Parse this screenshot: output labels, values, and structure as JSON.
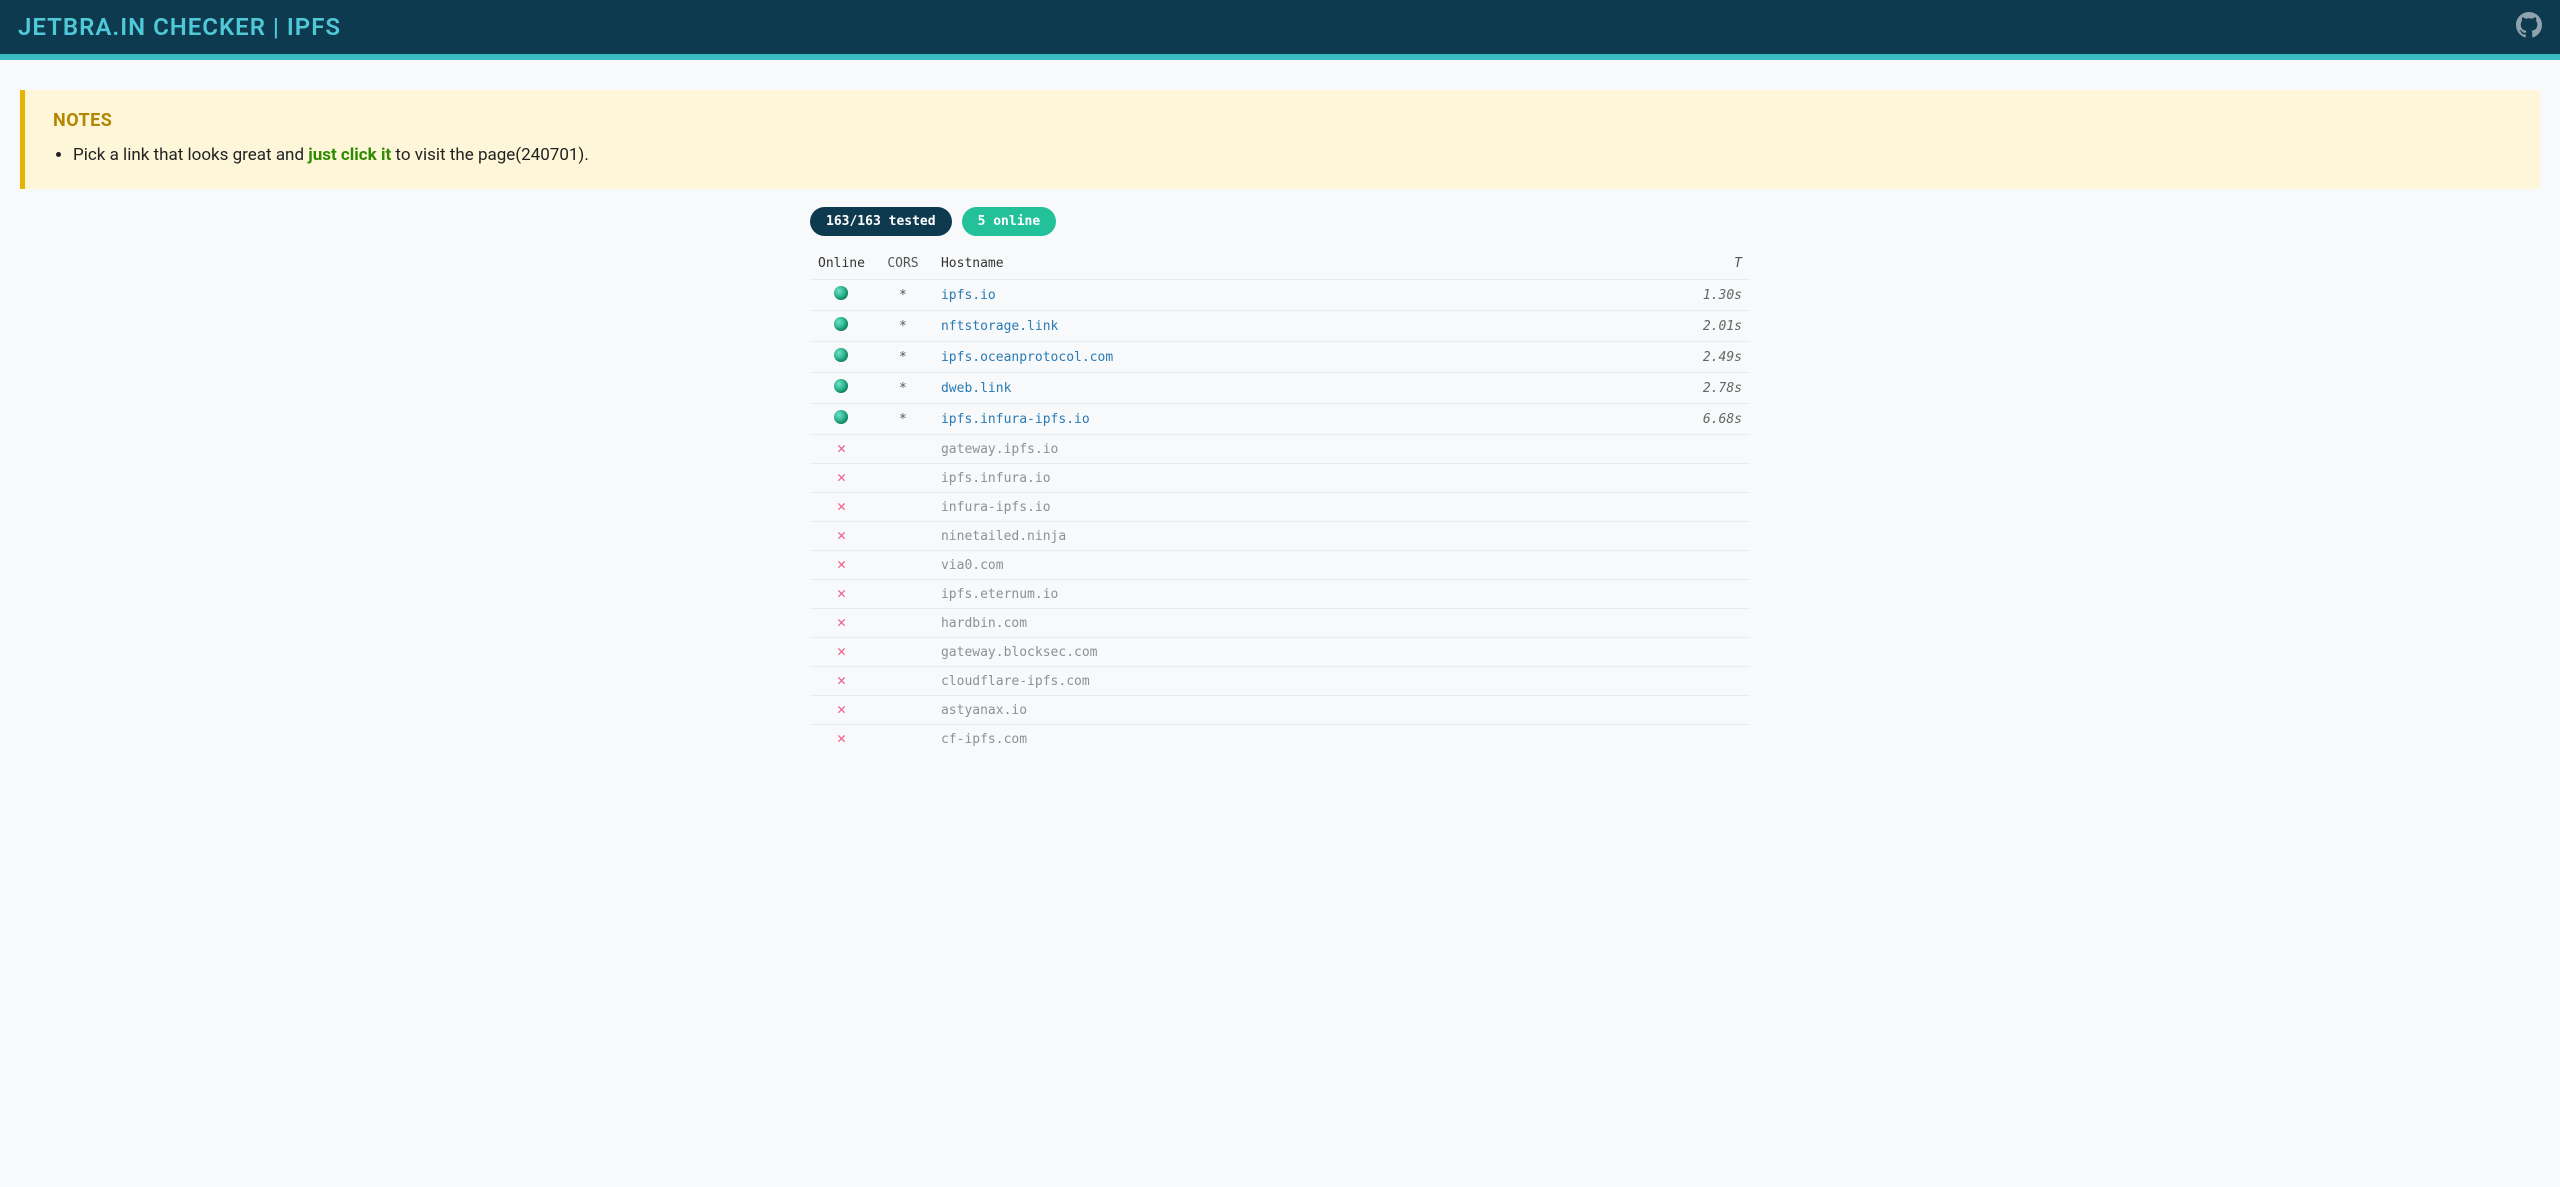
{
  "header": {
    "title": "JETBRA.IN CHECKER | IPFS"
  },
  "notes": {
    "heading": "NOTES",
    "line_pre": "Pick a link that looks great and ",
    "line_emph": "just click it",
    "line_post": " to visit the page(240701)."
  },
  "badges": {
    "tested": "163/163 tested",
    "online": "5 online"
  },
  "table": {
    "headers": {
      "online": "Online",
      "cors": "CORS",
      "hostname": "Hostname",
      "t": "T"
    },
    "rows": [
      {
        "online": true,
        "cors": "*",
        "host": "ipfs.io",
        "t": "1.30s"
      },
      {
        "online": true,
        "cors": "*",
        "host": "nftstorage.link",
        "t": "2.01s"
      },
      {
        "online": true,
        "cors": "*",
        "host": "ipfs.oceanprotocol.com",
        "t": "2.49s"
      },
      {
        "online": true,
        "cors": "*",
        "host": "dweb.link",
        "t": "2.78s"
      },
      {
        "online": true,
        "cors": "*",
        "host": "ipfs.infura-ipfs.io",
        "t": "6.68s"
      },
      {
        "online": false,
        "cors": "",
        "host": "gateway.ipfs.io",
        "t": ""
      },
      {
        "online": false,
        "cors": "",
        "host": "ipfs.infura.io",
        "t": ""
      },
      {
        "online": false,
        "cors": "",
        "host": "infura-ipfs.io",
        "t": ""
      },
      {
        "online": false,
        "cors": "",
        "host": "ninetailed.ninja",
        "t": ""
      },
      {
        "online": false,
        "cors": "",
        "host": "via0.com",
        "t": ""
      },
      {
        "online": false,
        "cors": "",
        "host": "ipfs.eternum.io",
        "t": ""
      },
      {
        "online": false,
        "cors": "",
        "host": "hardbin.com",
        "t": ""
      },
      {
        "online": false,
        "cors": "",
        "host": "gateway.blocksec.com",
        "t": ""
      },
      {
        "online": false,
        "cors": "",
        "host": "cloudflare-ipfs.com",
        "t": ""
      },
      {
        "online": false,
        "cors": "",
        "host": "astyanax.io",
        "t": ""
      },
      {
        "online": false,
        "cors": "",
        "host": "cf-ipfs.com",
        "t": ""
      }
    ]
  }
}
